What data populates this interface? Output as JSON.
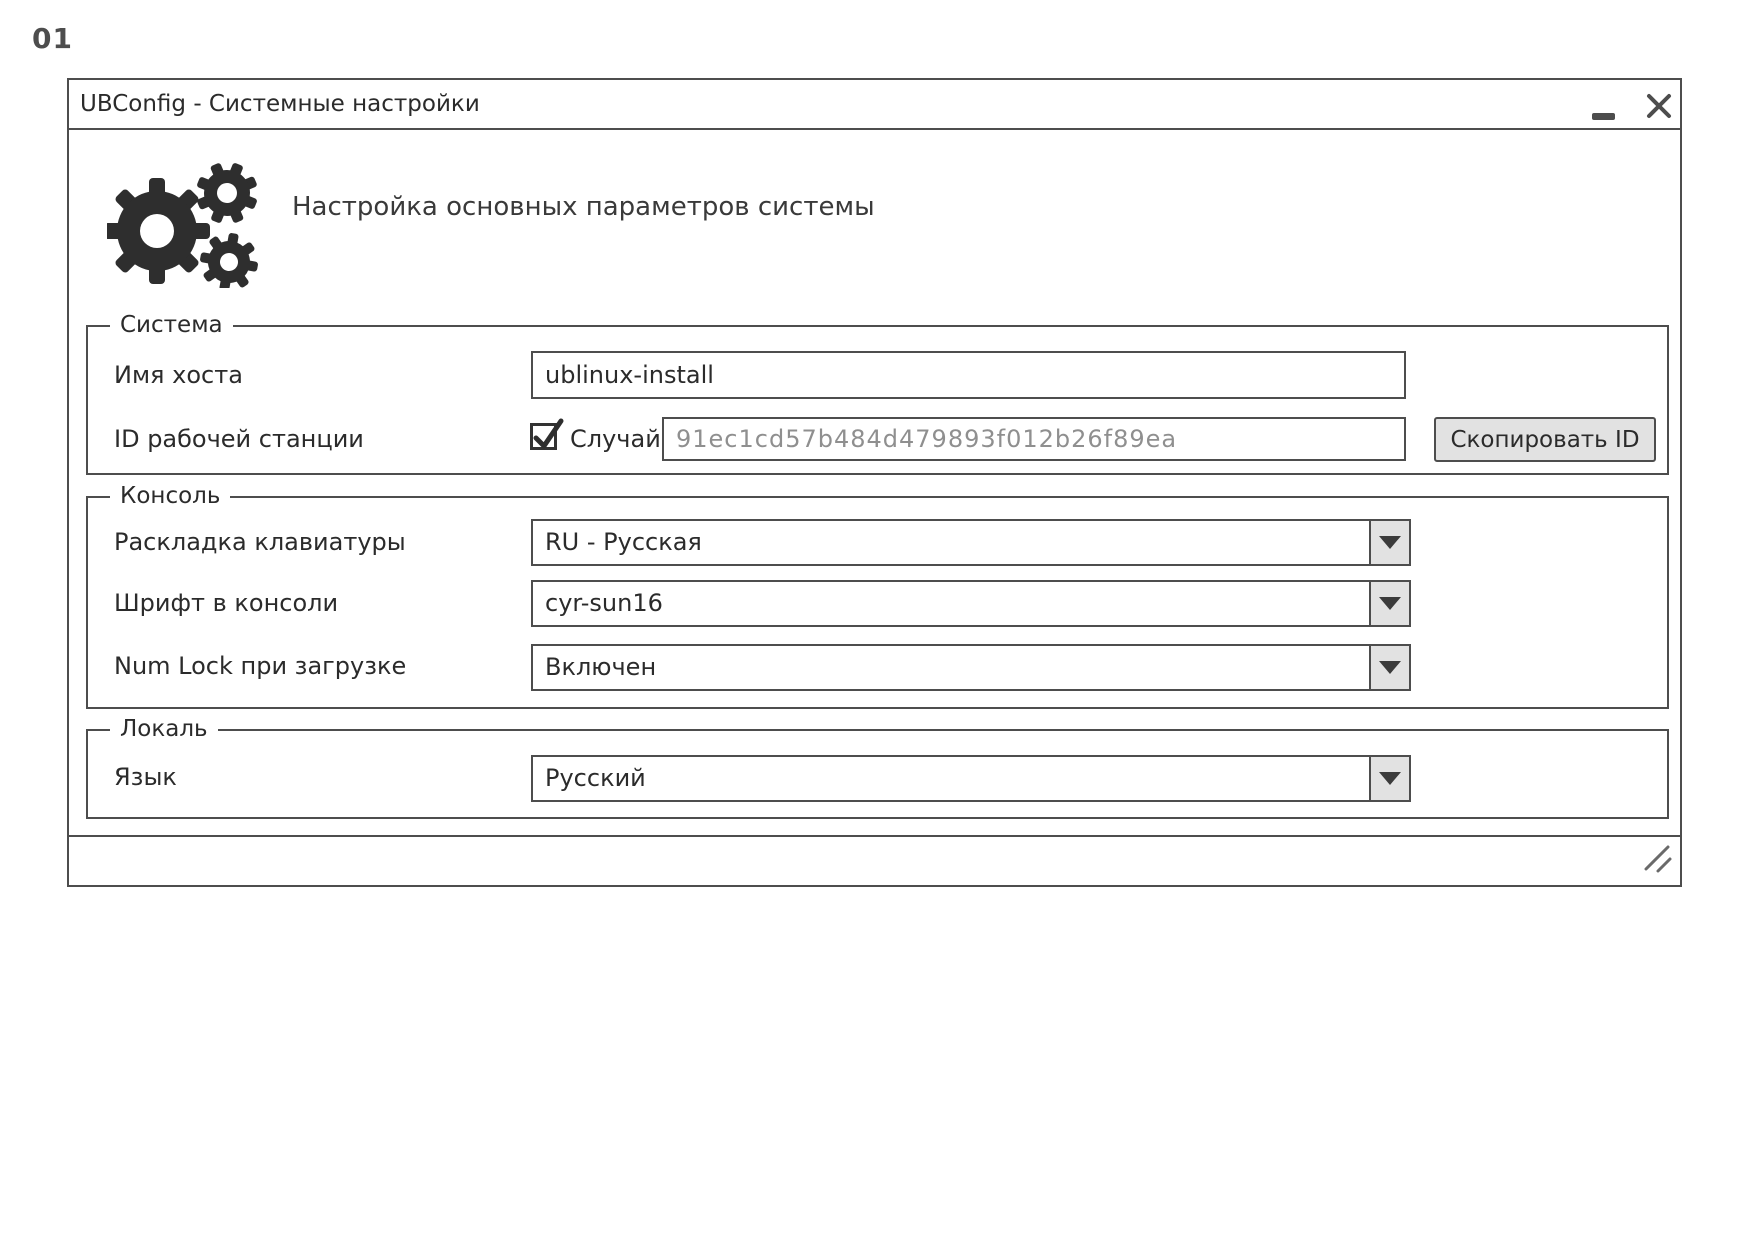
{
  "page": {
    "figure_label": "01"
  },
  "window": {
    "title": "UBConfig - Системные настройки",
    "subtitle": "Настройка основных параметров системы"
  },
  "groups": {
    "system": {
      "title": "Система",
      "hostname": {
        "label": "Имя хоста",
        "value": "ublinux-install"
      },
      "workstation_id": {
        "label": "ID рабочей станции",
        "random_checkbox_label": "Случайный",
        "random_checked": true,
        "value": "91ec1cd57b484d479893f012b26f89ea",
        "copy_button_label": "Скопировать ID"
      }
    },
    "console": {
      "title": "Консоль",
      "keyboard_layout": {
        "label": "Раскладка клавиатуры",
        "value": "RU - Русская"
      },
      "console_font": {
        "label": "Шрифт в консоли",
        "value": "cyr-sun16"
      },
      "numlock": {
        "label": "Num Lock при загрузке",
        "value": "Включен"
      }
    },
    "locale": {
      "title": "Локаль",
      "language": {
        "label": "Язык",
        "value": "Русский"
      }
    }
  },
  "icons": {
    "app": "gears-icon",
    "minimize": "minimize-icon",
    "close": "close-icon",
    "dropdown": "chevron-down-icon",
    "resize": "resize-grip-icon"
  },
  "colors": {
    "border": "#4d4d4d",
    "text": "#2b2b2b",
    "muted_text": "#8f8f8f",
    "button_bg": "#e2e2e2",
    "icon": "#2e2e2e"
  }
}
